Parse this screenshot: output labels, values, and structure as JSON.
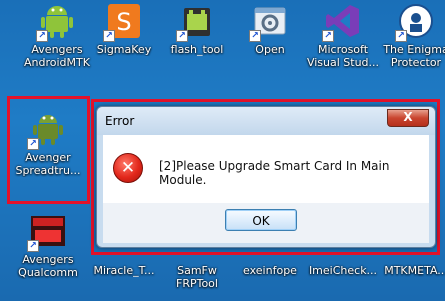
{
  "desktop_icons_top": [
    {
      "label": "Avengers\nAndroidMTK",
      "icon": "android-robot-icon"
    },
    {
      "label": "SigmaKey",
      "icon": "sigmakey-s-icon"
    },
    {
      "label": "flash_tool",
      "icon": "flash-tool-android-icon"
    },
    {
      "label": "Open",
      "icon": "settings-window-icon"
    },
    {
      "label": "Microsoft\nVisual Stud...",
      "icon": "visual-studio-icon"
    },
    {
      "label": "The Enigma\nProtector",
      "icon": "enigma-protector-icon"
    }
  ],
  "desktop_icon_mid": {
    "label": "Avenger\nSpreadtru...",
    "icon": "android-robot-icon"
  },
  "desktop_icons_bottom": [
    {
      "label": "Avengers\nQualcomm",
      "icon": "avengers-box-icon"
    },
    {
      "label": "Miracle_T...",
      "icon": "miracle-icon"
    },
    {
      "label": "SamFw\nFRPTool",
      "icon": "samfw-icon"
    },
    {
      "label": "exeinfope",
      "icon": "exeinfope-icon"
    },
    {
      "label": "ImeiCheck...",
      "icon": "imei-check-icon"
    },
    {
      "label": "MTKMETA...",
      "icon": "mtkmeta-icon"
    }
  ],
  "dialog": {
    "title": "Error",
    "close_label": "X",
    "message": "[2]Please Upgrade Smart Card In Main Module.",
    "ok_label": "OK"
  },
  "colors": {
    "highlight_frame": "#e3122a",
    "desktop": "#1f7cc6"
  }
}
